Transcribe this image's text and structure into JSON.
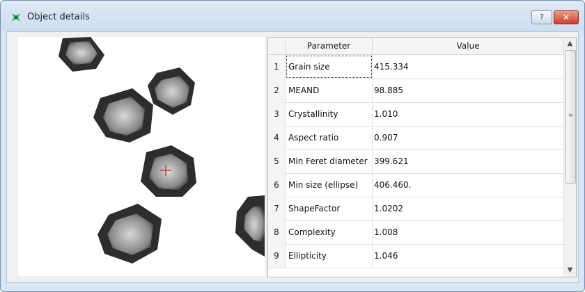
{
  "window": {
    "title": "Object details",
    "help_label": "?",
    "close_label": "✕"
  },
  "table": {
    "columns": [
      "Parameter",
      "Value"
    ],
    "rows": [
      {
        "num": "1",
        "parameter": "Grain size",
        "value": "415.334"
      },
      {
        "num": "2",
        "parameter": "MEAND",
        "value": "98.885"
      },
      {
        "num": "3",
        "parameter": "Crystallinity",
        "value": "1.010"
      },
      {
        "num": "4",
        "parameter": "Aspect ratio",
        "value": "0.907"
      },
      {
        "num": "5",
        "parameter": "Min Feret diameter",
        "value": "399.621"
      },
      {
        "num": "6",
        "parameter": "Min size (ellipse)",
        "value": "406.460."
      },
      {
        "num": "7",
        "parameter": "ShapeFactor",
        "value": "1.0202"
      },
      {
        "num": "8",
        "parameter": "Complexity",
        "value": "1.008"
      },
      {
        "num": "9",
        "parameter": "Ellipticity",
        "value": "1.046"
      }
    ]
  },
  "scroll": {
    "up": "▲",
    "down": "▼"
  }
}
